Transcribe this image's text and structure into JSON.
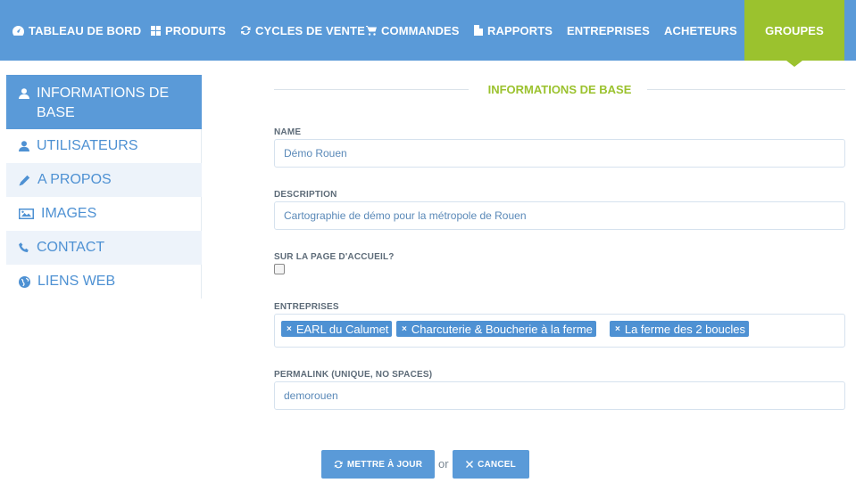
{
  "nav": {
    "items": [
      {
        "label": "TABLEAU DE BORD",
        "icon": "dashboard-icon"
      },
      {
        "label": "PRODUITS",
        "icon": "grid-icon"
      },
      {
        "label": "CYCLES DE VENTE",
        "icon": "refresh-icon"
      },
      {
        "label": "COMMANDES",
        "icon": "cart-icon"
      },
      {
        "label": "RAPPORTS",
        "icon": "file-icon"
      },
      {
        "label": "ENTREPRISES",
        "icon": ""
      },
      {
        "label": "ACHETEURS",
        "icon": ""
      },
      {
        "label": "GROUPES",
        "icon": ""
      }
    ],
    "active": "GROUPES",
    "active_color": "#9bc22e",
    "bar_color": "#5a9ad8"
  },
  "sidebar": {
    "items": [
      {
        "label": "INFORMATIONS DE BASE",
        "icon": "user-icon",
        "active": true
      },
      {
        "label": "UTILISATEURS",
        "icon": "user-icon"
      },
      {
        "label": "A PROPOS",
        "icon": "pencil-icon"
      },
      {
        "label": "IMAGES",
        "icon": "image-icon"
      },
      {
        "label": "CONTACT",
        "icon": "phone-icon"
      },
      {
        "label": "LIENS WEB",
        "icon": "globe-icon"
      }
    ]
  },
  "form": {
    "section_title": "INFORMATIONS DE BASE",
    "name_label": "NAME",
    "name_value": "Démo Rouen",
    "description_label": "DESCRIPTION",
    "description_value": "Cartographie de démo pour la métropole de Rouen",
    "homepage_label": "SUR LA PAGE D'ACCUEIL?",
    "homepage_checked": false,
    "companies_label": "ENTREPRISES",
    "companies": [
      "EARL du Calumet",
      "Charcuterie & Boucherie à la ferme",
      "La ferme des 2 boucles"
    ],
    "tag_remove_symbol": "×",
    "permalink_label": "PERMALINK (UNIQUE, NO SPACES)",
    "permalink_value": "demorouen"
  },
  "actions": {
    "update_label": "METTRE À JOUR",
    "or_text": "or",
    "cancel_label": "CANCEL"
  }
}
